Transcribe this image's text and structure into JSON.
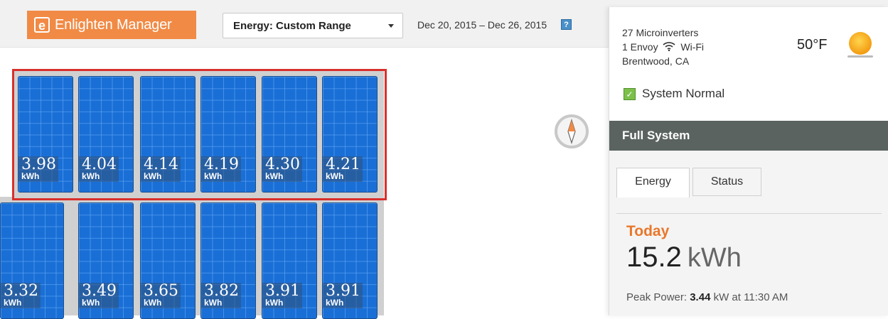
{
  "header": {
    "brand_mark": "e",
    "brand_name": "Enlighten Manager",
    "range_select_value": "Energy: Custom Range",
    "date_range": "Dec 20, 2015 – Dec 26, 2015",
    "help_label": "?"
  },
  "array": {
    "unit": "kWh",
    "rows": [
      [
        "3.98",
        "4.04",
        "4.14",
        "4.19",
        "4.30",
        "4.21"
      ],
      [
        "3.32",
        "3.49",
        "3.65",
        "3.82",
        "3.91",
        "3.91"
      ]
    ],
    "highlight_color": "#d9302c",
    "panel_color": "#1a6fd6"
  },
  "site": {
    "microinverters": "27 Microinverters",
    "envoy": "1 Envoy",
    "connection": "Wi-Fi",
    "location": "Brentwood, CA",
    "temperature": "50°F",
    "weather_icon": "sun-icon",
    "status": "System Normal"
  },
  "system": {
    "title": "Full System",
    "tabs": [
      "Energy",
      "Status"
    ],
    "today_label": "Today",
    "today_value": "15.2",
    "today_unit": "kWh",
    "peak_prefix": "Peak Power: ",
    "peak_value": "3.44",
    "peak_unit": "kW",
    "peak_suffix": " at 11:30 AM"
  },
  "colors": {
    "accent_orange": "#f18a45",
    "status_green": "#7cc04b",
    "header_dark": "#5a6360"
  }
}
